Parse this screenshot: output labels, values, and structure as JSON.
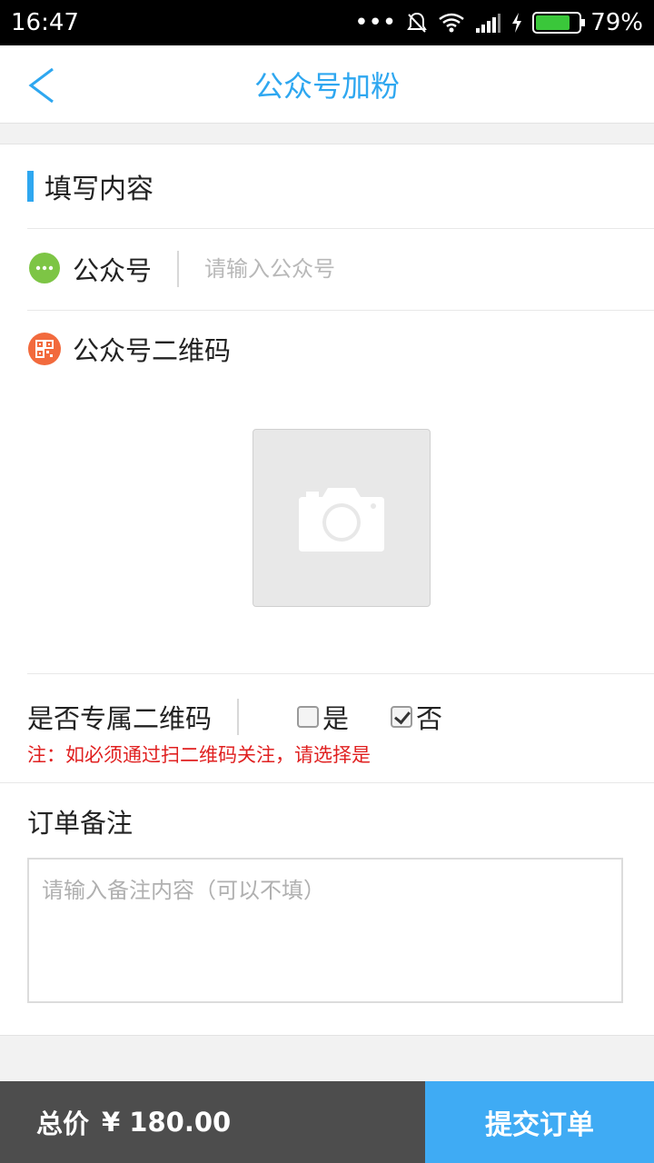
{
  "status_bar": {
    "time": "16:47",
    "battery_text": "79%",
    "battery_level": 0.79
  },
  "header": {
    "title": "公众号加粉",
    "back_icon": "chevron-left-icon"
  },
  "form": {
    "section_title": "填写内容",
    "account": {
      "label": "公众号",
      "placeholder": "请输入公众号",
      "value": "",
      "icon": "wechat-icon"
    },
    "qr_code": {
      "label": "公众号二维码",
      "icon": "qr-code-icon",
      "upload_icon": "camera-icon"
    },
    "exclusive_qr": {
      "label": "是否专属二维码",
      "options": [
        {
          "label": "是",
          "checked": false
        },
        {
          "label": "否",
          "checked": true
        }
      ],
      "note": "注：如必须通过扫二维码关注，请选择是"
    },
    "remark": {
      "label": "订单备注",
      "placeholder": "请输入备注内容（可以不填）",
      "value": ""
    }
  },
  "footer": {
    "total_label": "总价",
    "total_value": "¥ 180.00",
    "submit_label": "提交订单"
  },
  "colors": {
    "accent": "#2ea7f0",
    "note_red": "#e02020",
    "total_bg": "#4d4d4d",
    "submit_bg": "#3fabf4"
  }
}
